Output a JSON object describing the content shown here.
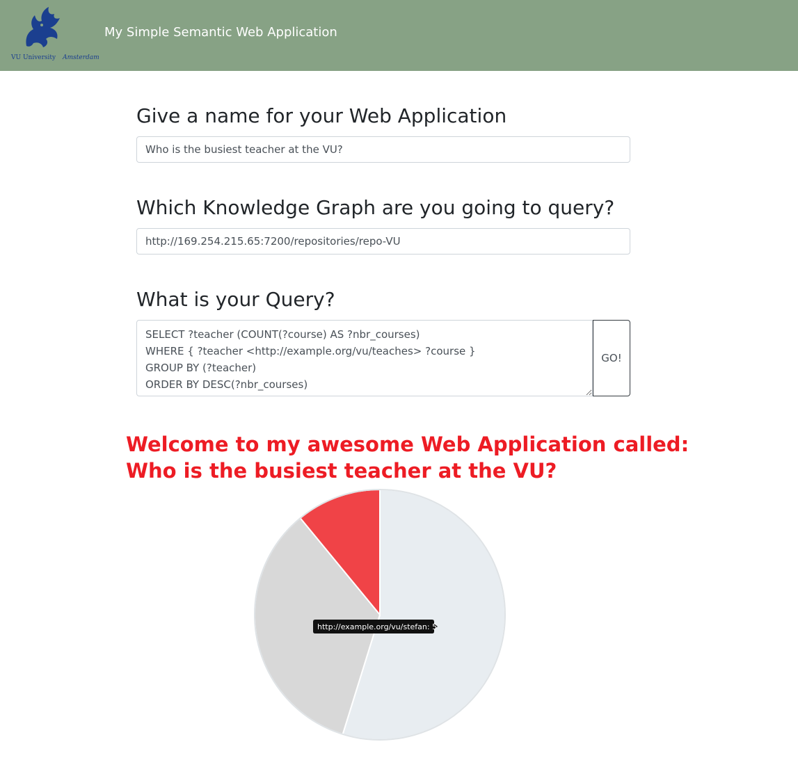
{
  "header": {
    "logo": {
      "icon": "vu-griffin-logo",
      "university": "VU University",
      "city": "Amsterdam"
    },
    "app_title": "My Simple Semantic Web Application"
  },
  "form": {
    "name_label": "Give a name for your Web Application",
    "name_value": "Who is the busiest teacher at the VU?",
    "kg_label": "Which Knowledge Graph are you going to query?",
    "kg_value": "http://169.254.215.65:7200/repositories/repo-VU",
    "query_label": "What is your Query?",
    "query_value": "SELECT ?teacher (COUNT(?course) AS ?nbr_courses)\nWHERE { ?teacher <http://example.org/vu/teaches> ?course }\nGROUP BY (?teacher)\nORDER BY DESC(?nbr_courses)",
    "go_label": "GO!"
  },
  "result": {
    "welcome_line1": "Welcome to my awesome Web Application called:",
    "welcome_line2": "Who is the busiest teacher at the VU?"
  },
  "chart_data": {
    "type": "pie",
    "slices": [
      {
        "label": "",
        "value": 8,
        "color": "#e8edf1"
      },
      {
        "label": "http://example.org/vu/stefan",
        "value": 5,
        "color": "#d8d8d8"
      },
      {
        "label": "",
        "value": 1.6,
        "color": "#f04347"
      }
    ],
    "tooltip": "http://example.org/vu/stefan: 5",
    "colors": {
      "welcome_text": "#ed1c24",
      "navbar": "#87a285"
    }
  }
}
